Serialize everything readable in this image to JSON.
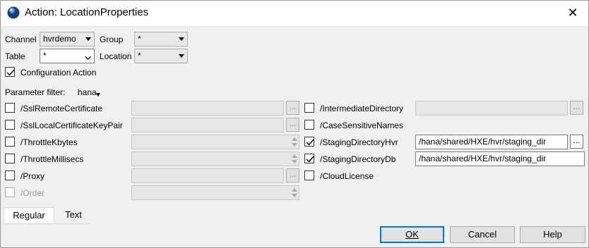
{
  "window": {
    "title": "Action: LocationProperties",
    "close_label": "✕"
  },
  "scope": {
    "channel_label": "Channel",
    "channel_value": "hvrdemo",
    "group_label": "Group",
    "group_value": "*",
    "table_label": "Table",
    "table_value": "*",
    "location_label": "Location",
    "location_value": "*",
    "config_action_label": "Configuration Action",
    "config_action_checked": true
  },
  "filter": {
    "label": "Parameter filter:",
    "value": "hana"
  },
  "params_left": [
    {
      "label": "/SslRemoteCertificate",
      "checked": false,
      "control": "browse"
    },
    {
      "label": "/SslLocalCertificateKeyPair",
      "checked": false,
      "control": "browse"
    },
    {
      "label": "/ThrottleKbytes",
      "checked": false,
      "control": "spin"
    },
    {
      "label": "/ThrottleMillisecs",
      "checked": false,
      "control": "spin"
    },
    {
      "label": "/Proxy",
      "checked": false,
      "control": "browse"
    },
    {
      "label": "/Order",
      "checked": false,
      "control": "spin",
      "disabled": true
    }
  ],
  "params_right": [
    {
      "label": "/IntermediateDirectory",
      "checked": false,
      "control": "browse"
    },
    {
      "label": "/CaseSensitiveNames",
      "checked": false
    },
    {
      "label": "/StagingDirectoryHvr",
      "checked": true,
      "control": "browse",
      "value": "/hana/shared/HXE/hvr/staging_dir"
    },
    {
      "label": "/StagingDirectoryDb",
      "checked": true,
      "value": "/hana/shared/HXE/hvr/staging_dir"
    },
    {
      "label": "/CloudLicense",
      "checked": false
    }
  ],
  "browse_label": "...",
  "tabs": [
    {
      "label": "Regular",
      "active": true
    },
    {
      "label": "Text",
      "active": false
    }
  ],
  "buttons": {
    "ok": "OK",
    "cancel": "Cancel",
    "help": "Help"
  }
}
